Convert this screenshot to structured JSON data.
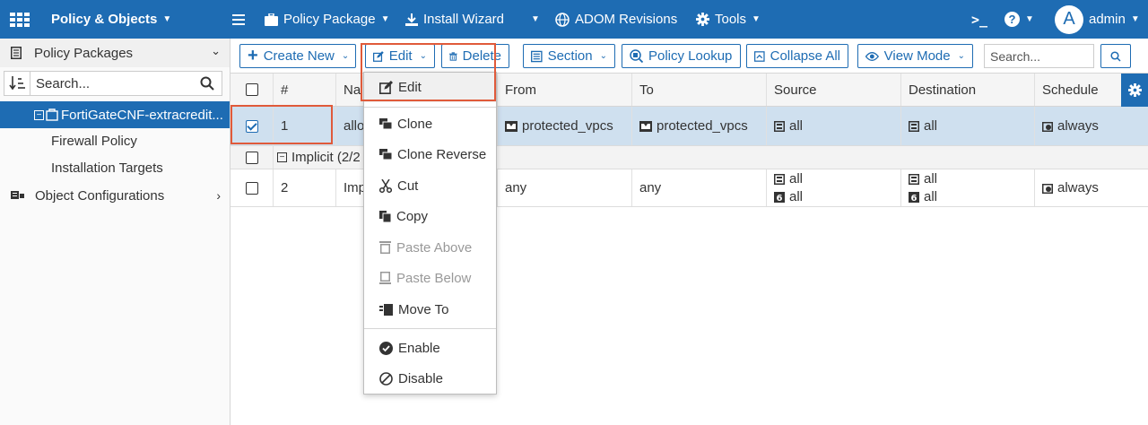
{
  "topbar": {
    "app_title": "Policy & Objects",
    "menu": [
      "Policy Package",
      "Install Wizard",
      "ADOM Revisions",
      "Tools"
    ],
    "avatar_letter": "A",
    "user": "admin",
    "colors": {
      "brand": "#1e6cb3",
      "highlight": "#e05a3a"
    }
  },
  "sidebar": {
    "header": "Policy Packages",
    "search_placeholder": "Search...",
    "package": "FortiGateCNF-extracredit...",
    "children": [
      "Firewall Policy",
      "Installation Targets"
    ],
    "object_config": "Object Configurations"
  },
  "toolbar": {
    "create_new": "Create New",
    "edit": "Edit",
    "delete": "Delete",
    "section": "Section",
    "policy_lookup": "Policy Lookup",
    "collapse_all": "Collapse All",
    "view_mode": "View Mode",
    "search_placeholder": "Search..."
  },
  "table": {
    "headers": [
      "#",
      "Na",
      "From",
      "To",
      "Source",
      "Destination",
      "Schedule"
    ],
    "rows": [
      {
        "num": "1",
        "name": "allo",
        "from": "protected_vpcs",
        "to": "protected_vpcs",
        "source": "all",
        "destination": "all",
        "schedule": "always",
        "selected": true
      },
      {
        "num": "2",
        "name": "Imp",
        "from": "any",
        "to": "any",
        "source": [
          "all",
          "all"
        ],
        "destination": [
          "all",
          "all"
        ],
        "schedule": "always",
        "selected": false
      }
    ],
    "group_label": "Implicit (2/2"
  },
  "dropdown": {
    "items": [
      "Edit",
      "Clone",
      "Clone Reverse",
      "Cut",
      "Copy",
      "Paste Above",
      "Paste Below",
      "Move To",
      "Enable",
      "Disable"
    ],
    "disabled": [
      "Paste Above",
      "Paste Below"
    ]
  }
}
